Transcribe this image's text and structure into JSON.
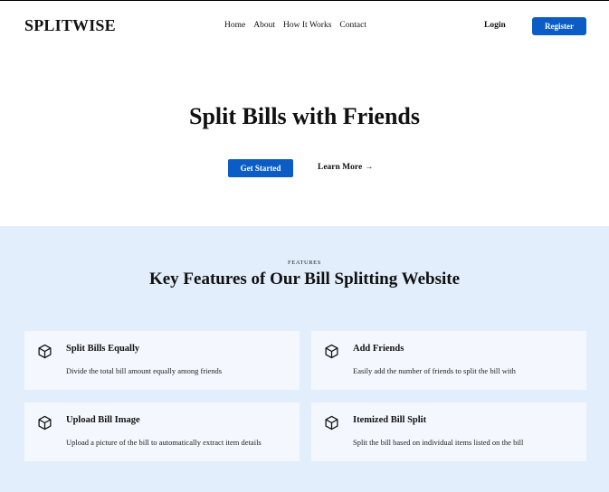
{
  "brand": {
    "name": "SPLITWISE"
  },
  "nav": {
    "items": [
      {
        "label": "Home"
      },
      {
        "label": "About"
      },
      {
        "label": "How It Works"
      },
      {
        "label": "Contact"
      }
    ]
  },
  "auth": {
    "login_label": "Login",
    "register_label": "Register"
  },
  "hero": {
    "title": "Split Bills with Friends",
    "primary_cta": "Get Started",
    "secondary_cta": "Learn More",
    "secondary_arrow": "→"
  },
  "features": {
    "eyebrow": "FEATURES",
    "title": "Key Features of Our Bill Splitting Website",
    "cards": [
      {
        "icon": "cube-icon",
        "title": "Split Bills Equally",
        "description": "Divide the total bill amount equally among friends"
      },
      {
        "icon": "cube-icon",
        "title": "Add Friends",
        "description": "Easily add the number of friends to split the bill with"
      },
      {
        "icon": "cube-icon",
        "title": "Upload Bill Image",
        "description": "Upload a picture of the bill to automatically extract item details"
      },
      {
        "icon": "cube-icon",
        "title": "Itemized Bill Split",
        "description": "Split the bill based on individual items listed on the bill"
      }
    ]
  },
  "colors": {
    "accent": "#0b5cc4",
    "features_bg": "#e3eefd",
    "card_bg": "#f4f8fe"
  }
}
